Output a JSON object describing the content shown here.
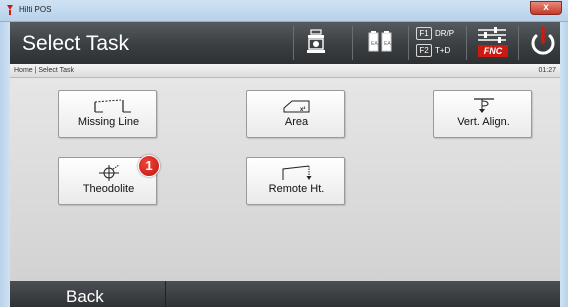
{
  "window": {
    "title": "Hilti POS",
    "close_glyph": "x"
  },
  "header": {
    "title": "Select Task",
    "f1": {
      "key": "F1",
      "label": "DR/P"
    },
    "f2": {
      "key": "F2",
      "label": "T+D"
    },
    "fnc_label": "FNC"
  },
  "breadcrumb": {
    "path": "Home | Select Task",
    "time": "01:27"
  },
  "tasks": {
    "missing_line": "Missing Line",
    "area": "Area",
    "vert_align": "Vert. Align.",
    "theodolite": "Theodolite",
    "remote_ht": "Remote Ht."
  },
  "callout": {
    "number": "1"
  },
  "footer": {
    "back_label": "Back"
  },
  "colors": {
    "accent_red": "#cc1a12",
    "header_dark": "#3b3f42",
    "content_gray": "#dcdcdc"
  }
}
